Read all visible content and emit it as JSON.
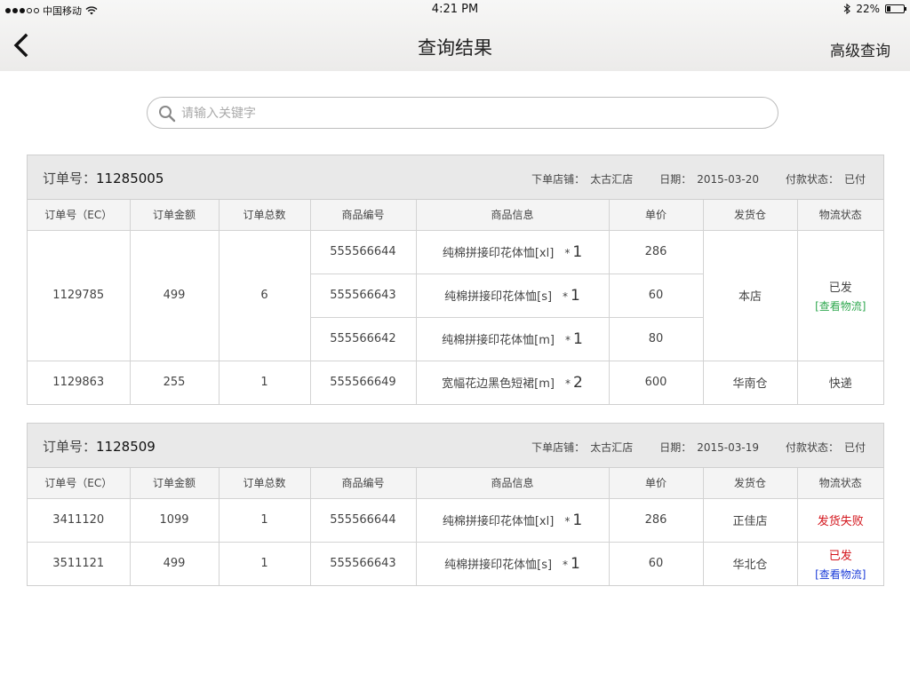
{
  "status_bar": {
    "carrier": "中国移动",
    "time": "4:21 PM",
    "battery": "22%",
    "battery_level": 0.22,
    "icons": [
      "signal-dots-icon",
      "wifi-icon",
      "bluetooth-icon",
      "battery-icon"
    ]
  },
  "nav": {
    "back_icon": "chevron-left-icon",
    "title": "查询结果",
    "advanced_label": "高级查询"
  },
  "search": {
    "icon": "search-icon",
    "placeholder": "请输入关键字"
  },
  "columns": [
    "订单号（EC）",
    "订单金额",
    "订单总数",
    "商品编号",
    "商品信息",
    "单价",
    "发货仓",
    "物流状态"
  ],
  "orders": [
    {
      "order_no_label": "订单号：",
      "order_no": "11285005",
      "store_label": "下单店铺：",
      "store": "太古汇店",
      "date_label": "日期：",
      "date": "2015-03-20",
      "pay_label": "付款状态：",
      "pay_status": "已付",
      "rows": [
        {
          "ec": "1129785",
          "amount": "499",
          "count": "6",
          "items": [
            {
              "code": "555566644",
              "info": "纯棉拼接印花体恤[xl]",
              "qty_prefix": "*",
              "qty": "1",
              "price": "286"
            },
            {
              "code": "555566643",
              "info": "纯棉拼接印花体恤[s]",
              "qty_prefix": "*",
              "qty": "1",
              "price": "60"
            },
            {
              "code": "555566642",
              "info": "纯棉拼接印花体恤[m]",
              "qty_prefix": "*",
              "qty": "1",
              "price": "80"
            }
          ],
          "warehouse": "本店",
          "logistics_status": "已发",
          "logistics_link": "[查看物流]"
        },
        {
          "ec": "1129863",
          "amount": "255",
          "count": "1",
          "items": [
            {
              "code": "555566649",
              "info": "宽幅花边黑色短裙[m]",
              "qty_prefix": "*",
              "qty": "2",
              "price": "600"
            }
          ],
          "warehouse": "华南仓",
          "logistics_status": "快递"
        }
      ]
    },
    {
      "order_no_label": "订单号：",
      "order_no": "1128509",
      "store_label": "下单店铺：",
      "store": "太古汇店",
      "date_label": "日期：",
      "date": "2015-03-19",
      "pay_label": "付款状态：",
      "pay_status": "已付",
      "rows": [
        {
          "ec": "3411120",
          "amount": "1099",
          "count": "1",
          "items": [
            {
              "code": "555566644",
              "info": "纯棉拼接印花体恤[xl]",
              "qty_prefix": "*",
              "qty": "1",
              "price": "286"
            }
          ],
          "warehouse": "正佳店",
          "logistics_status": "发货失败"
        },
        {
          "ec": "3511121",
          "amount": "499",
          "count": "1",
          "items": [
            {
              "code": "555566643",
              "info": "纯棉拼接印花体恤[s]",
              "qty_prefix": "*",
              "qty": "1",
              "price": "60"
            }
          ],
          "warehouse": "华北仓",
          "logistics_status": "已发",
          "logistics_link": "[查看物流]"
        }
      ]
    }
  ],
  "colors": {
    "link_green": "#2fa84f",
    "link_blue": "#1a3bd8",
    "status_red": "#d3141b",
    "header_bg": "#e9e9e9"
  }
}
